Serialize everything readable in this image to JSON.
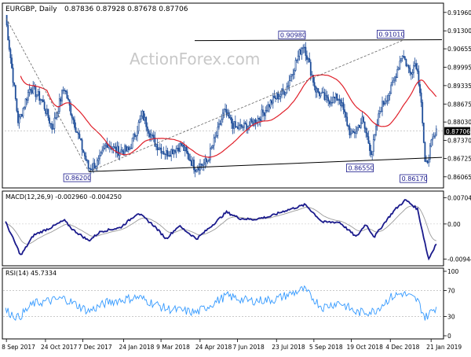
{
  "header": {
    "symbol_label": "EURGBP, Daily",
    "ohlc": "0.87836 0.87928 0.87678 0.87706",
    "watermark": "ActionForex.com"
  },
  "colors": {
    "background": "#ffffff",
    "candle": "#1f4e9a",
    "ma_line": "#e0202a",
    "macd_line": "#1a1a8c",
    "signal_line": "#9a9a9a",
    "rsi_line": "#3399ff",
    "dashed": "#666666",
    "trendline": "#000000",
    "label_box": "#1a1a8c",
    "current_price_bg": "#000000"
  },
  "chart_data": [
    {
      "type": "candlestick",
      "panel": "price",
      "title": "EURGBP, Daily",
      "y_ticks": [
        "0.91960",
        "0.91300",
        "0.90655",
        "0.89995",
        "0.89335",
        "0.88675",
        "0.88030",
        "0.87370",
        "0.86725",
        "0.86065"
      ],
      "ylim": [
        0.8575,
        0.9218
      ],
      "current_price": "0.87706",
      "annotations": [
        {
          "label": "0.86200",
          "date": "2017-12-14",
          "value": 0.862
        },
        {
          "label": "0.90980",
          "date": "2018-08-24",
          "value": 0.9098
        },
        {
          "label": "0.86550",
          "date": "2018-11-12",
          "value": 0.8655
        },
        {
          "label": "0.91010",
          "date": "2018-12-18",
          "value": 0.9101
        },
        {
          "label": "0.86170",
          "date": "2019-01-14",
          "value": 0.8617
        }
      ],
      "ma_series": "moving average (red)"
    },
    {
      "type": "line",
      "panel": "macd",
      "title": "MACD(12,26,9) -0.002960 -0.004250",
      "series": [
        {
          "name": "MACD",
          "value": -0.00296
        },
        {
          "name": "Signal",
          "value": -0.00425
        }
      ],
      "y_ticks": [
        "0.007045",
        "0.00",
        "-0.00944"
      ],
      "ylim": [
        -0.0104,
        0.0078
      ]
    },
    {
      "type": "line",
      "panel": "rsi",
      "title": "RSI(14) 45.7334",
      "value": 45.7334,
      "y_ticks": [
        "100",
        "70",
        "30",
        "0"
      ],
      "levels": [
        70,
        30
      ],
      "ylim": [
        0,
        100
      ]
    }
  ],
  "x_axis": {
    "ticks": [
      "8 Sep 2017",
      "24 Oct 2017",
      "7 Dec 2017",
      "24 Jan 2018",
      "9 Mar 2018",
      "24 Apr 2018",
      "7 Jun 2018",
      "23 Jul 2018",
      "5 Sep 2018",
      "19 Oct 2018",
      "4 Dec 2018",
      "21 Jan 2019"
    ]
  }
}
